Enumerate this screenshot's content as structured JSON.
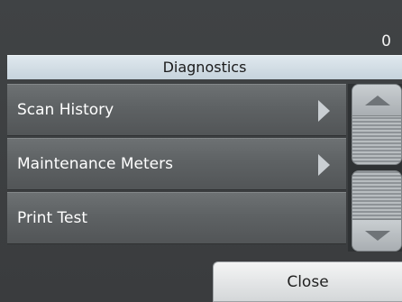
{
  "status": {
    "counter": "0"
  },
  "header": {
    "title": "Diagnostics"
  },
  "menu": {
    "items": [
      {
        "label": "Scan History"
      },
      {
        "label": "Maintenance Meters"
      },
      {
        "label": "Print Test"
      }
    ]
  },
  "footer": {
    "close_label": "Close"
  },
  "icons": {
    "submenu_arrow": "chevron-right-icon",
    "scroll_up": "arrow-up-icon",
    "scroll_down": "arrow-down-icon"
  }
}
